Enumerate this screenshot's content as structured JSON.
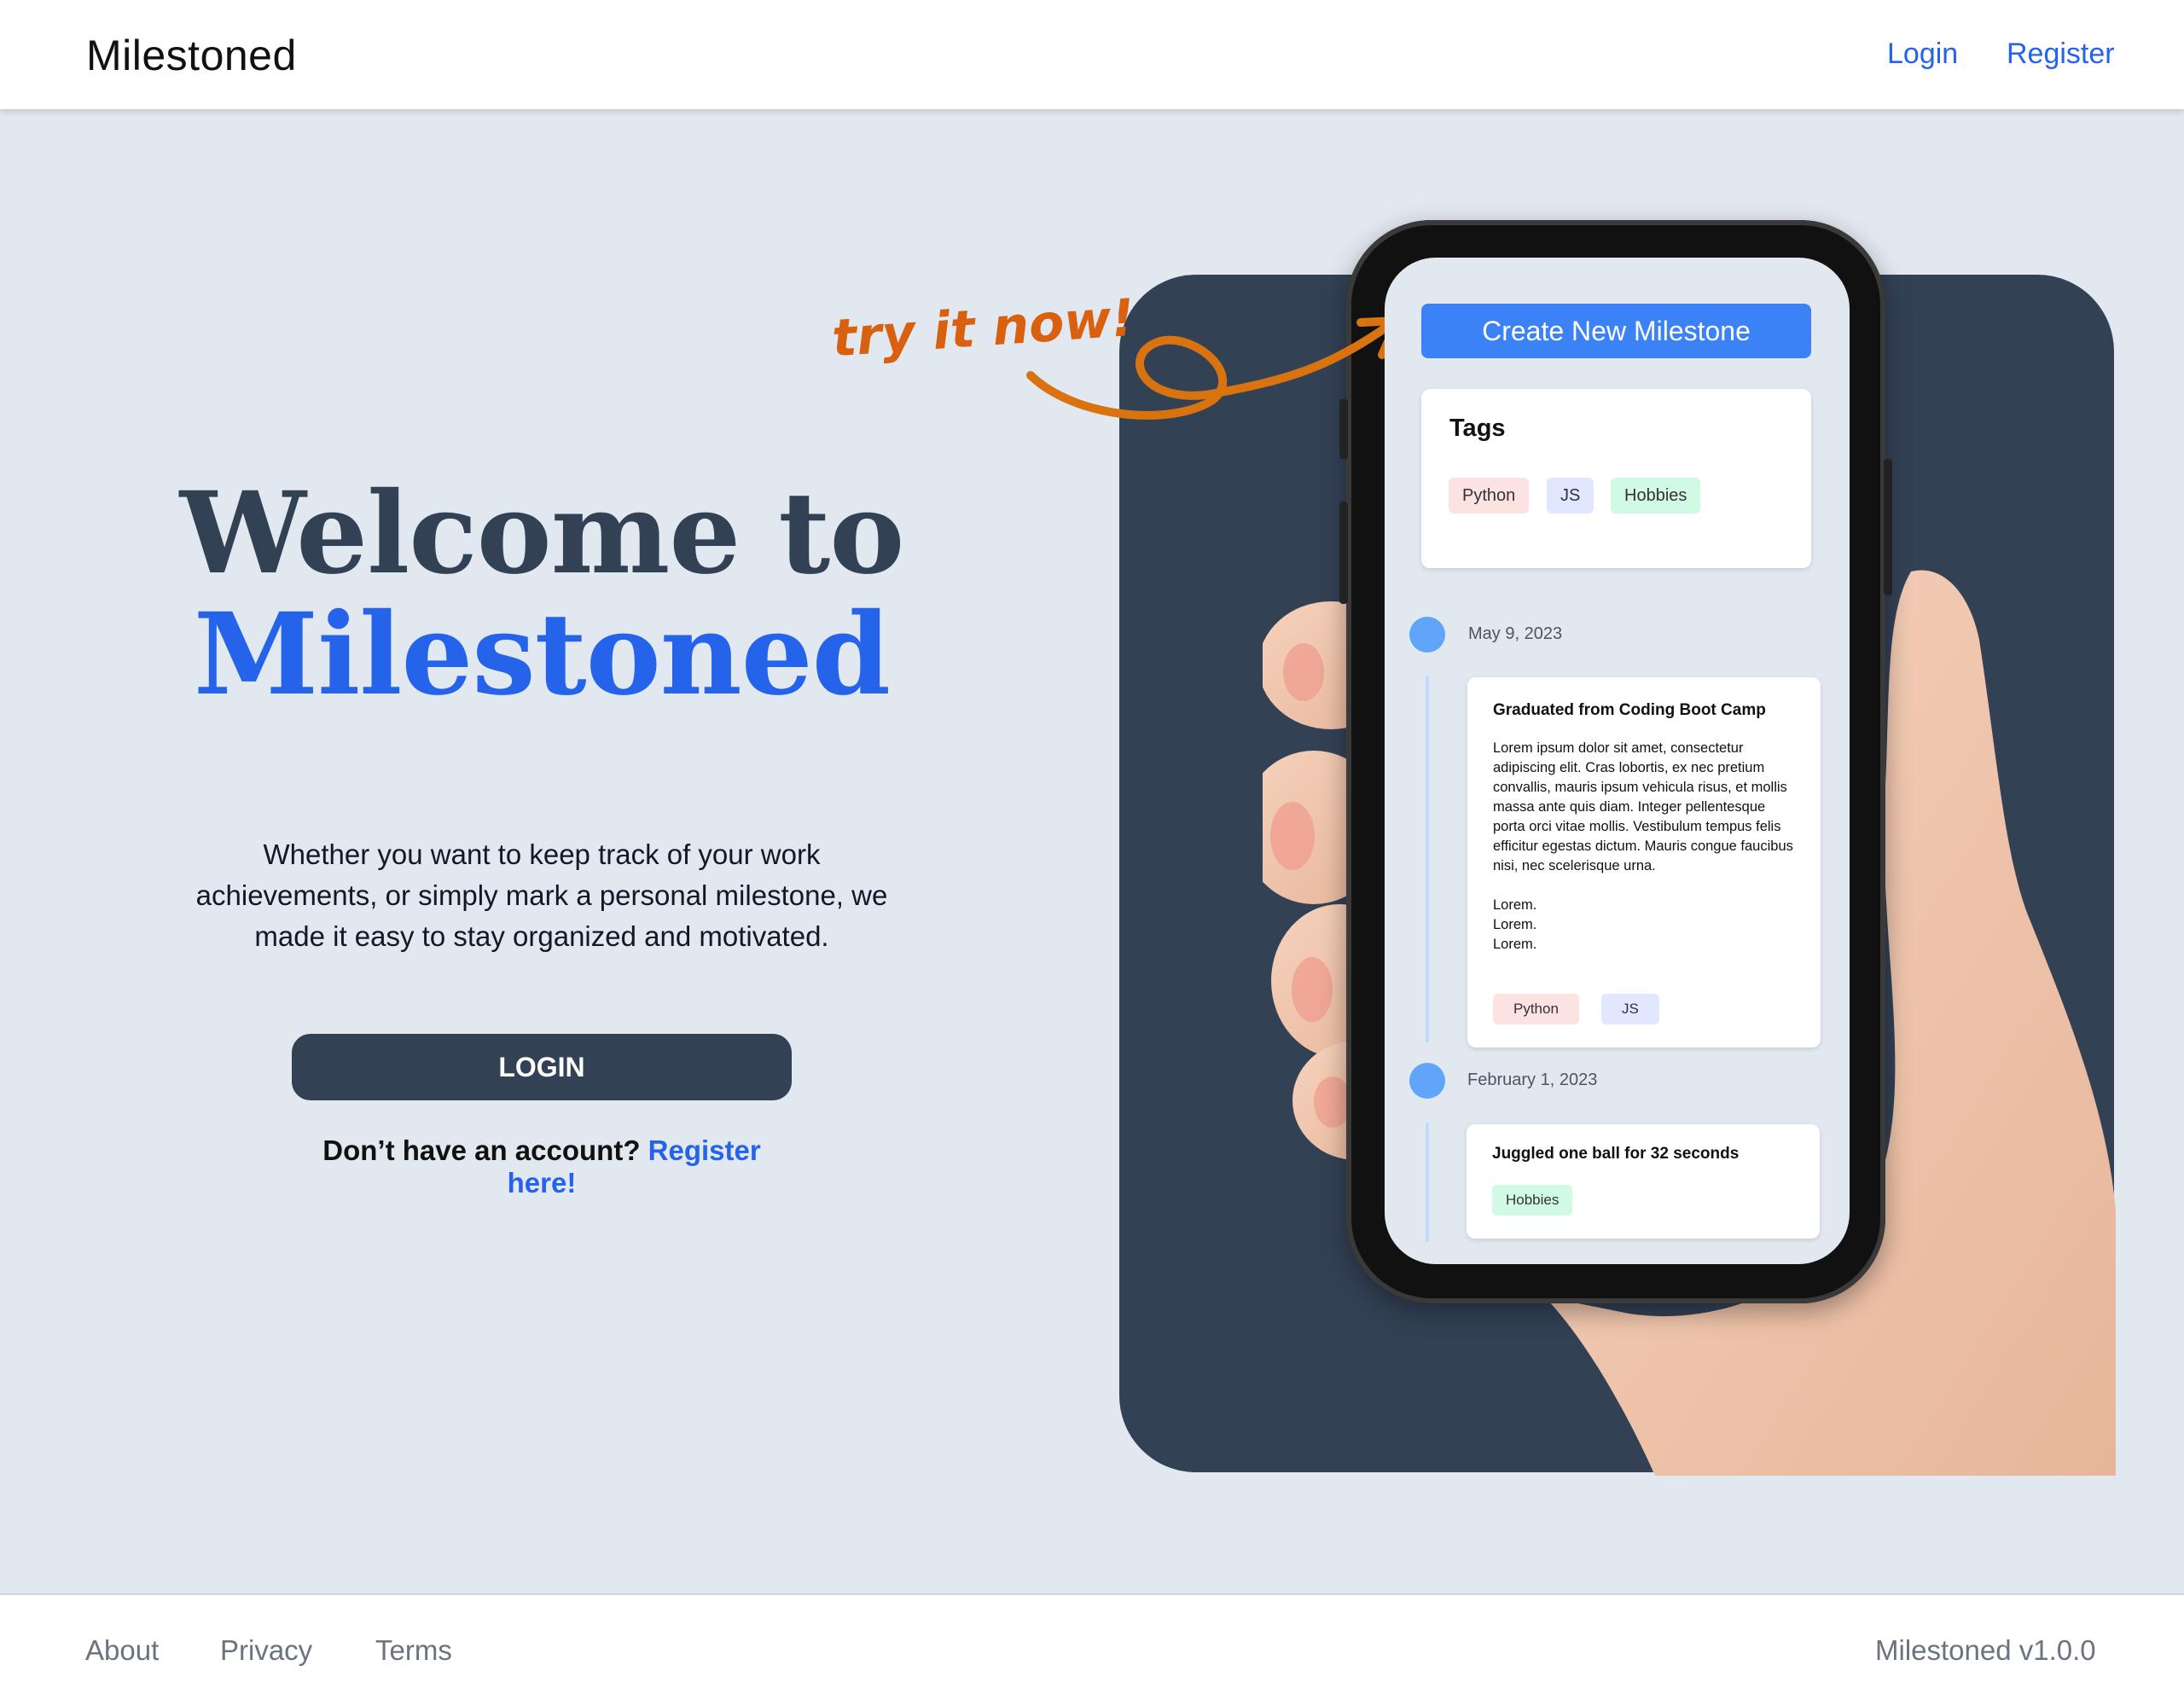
{
  "header": {
    "brand": "Milestoned",
    "nav": {
      "login": "Login",
      "register": "Register"
    }
  },
  "hero": {
    "title_line1": "Welcome to",
    "title_line2": "Milestoned",
    "subtitle": "Whether you want to keep track of your work achievements, or simply mark a personal milestone, we made it easy to stay organized and motivated.",
    "login_button": "LOGIN",
    "register_prompt": "Don’t have an account?",
    "register_link": "Register here!"
  },
  "callout": {
    "text": "try it now!"
  },
  "phone_screen": {
    "create_button": "Create New Milestone",
    "tags_card": {
      "title": "Tags",
      "tags": [
        "Python",
        "JS",
        "Hobbies"
      ]
    },
    "timeline": [
      {
        "date": "May 9, 2023",
        "title": "Graduated from Coding Boot Camp",
        "body": "Lorem ipsum dolor sit amet, consectetur adipiscing elit. Cras lobortis, ex nec pretium convallis, mauris ipsum vehicula risus, et mollis massa ante quis diam. Integer pellentesque porta orci vitae mollis. Vestibulum tempus felis efficitur egestas dictum. Mauris congue faucibus nisi, nec scelerisque urna.\n\nLorem.\nLorem.\nLorem.",
        "tags": [
          "Python",
          "JS"
        ]
      },
      {
        "date": "February 1, 2023",
        "title": "Juggled one ball for 32 seconds",
        "tags": [
          "Hobbies"
        ]
      }
    ]
  },
  "colors": {
    "page_bg": "#e2e8f0",
    "accent": "#2563eb",
    "dark": "#334155",
    "callout": "#d9600f",
    "tag_python": "#fde2e2",
    "tag_js": "#e0e7ff",
    "tag_hobbies": "#d1fae5"
  },
  "footer": {
    "links": [
      "About",
      "Privacy",
      "Terms"
    ],
    "version": "Milestoned v1.0.0"
  }
}
